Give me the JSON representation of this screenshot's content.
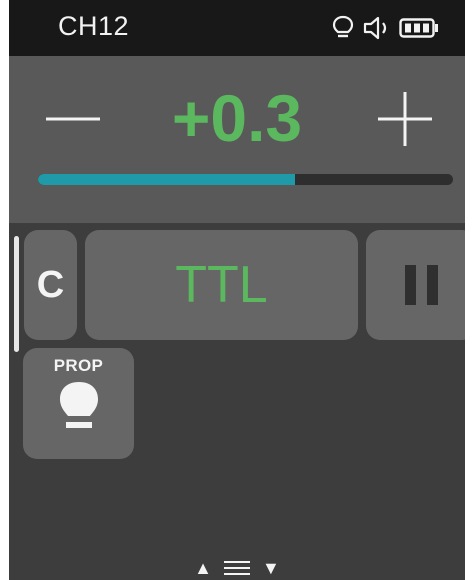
{
  "status_bar": {
    "channel": "CH12",
    "icons": [
      "modeling-lamp-icon",
      "speaker-icon",
      "battery-icon"
    ]
  },
  "power": {
    "minus_icon": "minus-icon",
    "value": "+0.3",
    "plus_icon": "plus-icon",
    "level_percent": 62
  },
  "modes": {
    "group_label": "C",
    "mode_label": "TTL",
    "pause_icon": "pause-icon"
  },
  "prop": {
    "label": "PROP",
    "icon": "bulb-icon"
  },
  "bottom_nav": {
    "up_arrow": "▲",
    "down_arrow": "▼",
    "menu_icon": "menu-icon"
  },
  "colors": {
    "accent_green": "#5bb85f",
    "progress_teal": "#1f9aa8"
  }
}
